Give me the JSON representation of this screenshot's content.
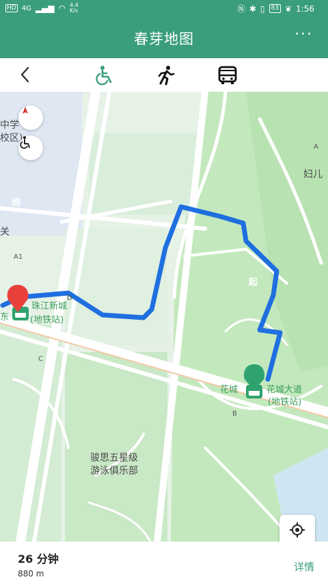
{
  "status_bar": {
    "network": "HD",
    "signal_text": "4G",
    "speed_value": "4.4",
    "speed_unit": "K/s",
    "battery": "83",
    "time": "1:56"
  },
  "header": {
    "title": "春芽地图",
    "more_label": "···"
  },
  "modes": [
    {
      "name": "wheelchair",
      "icon": "wheelchair-icon",
      "active": true
    },
    {
      "name": "walk",
      "icon": "walk-icon",
      "active": false
    },
    {
      "name": "bus",
      "icon": "bus-icon",
      "active": false
    }
  ],
  "map": {
    "labels": {
      "school_1": "中学",
      "school_2": "校区)",
      "guan": "关",
      "fuer": "妇儿",
      "a1": "A1",
      "a": "A",
      "b": "B",
      "c": "C",
      "d": "D",
      "station_end_1": "珠江新城",
      "station_end_2": "(地铁站)",
      "station_end_prefix": "东",
      "station_start_1": "花城大道",
      "station_start_2": "(地铁站)",
      "station_start_prefix": "花城",
      "club_1": "骏思五星级",
      "club_2": "游泳俱乐部"
    },
    "markers": {
      "start": "起",
      "end": "终"
    },
    "colors": {
      "route": "#1f6fe0",
      "marker_end": "#e8413c",
      "marker_start": "#2fa36e",
      "park": "#bfe5b9",
      "road": "#ffffff"
    }
  },
  "route": {
    "duration": "26 分钟",
    "distance": "880 m",
    "detail_label": "详情"
  }
}
